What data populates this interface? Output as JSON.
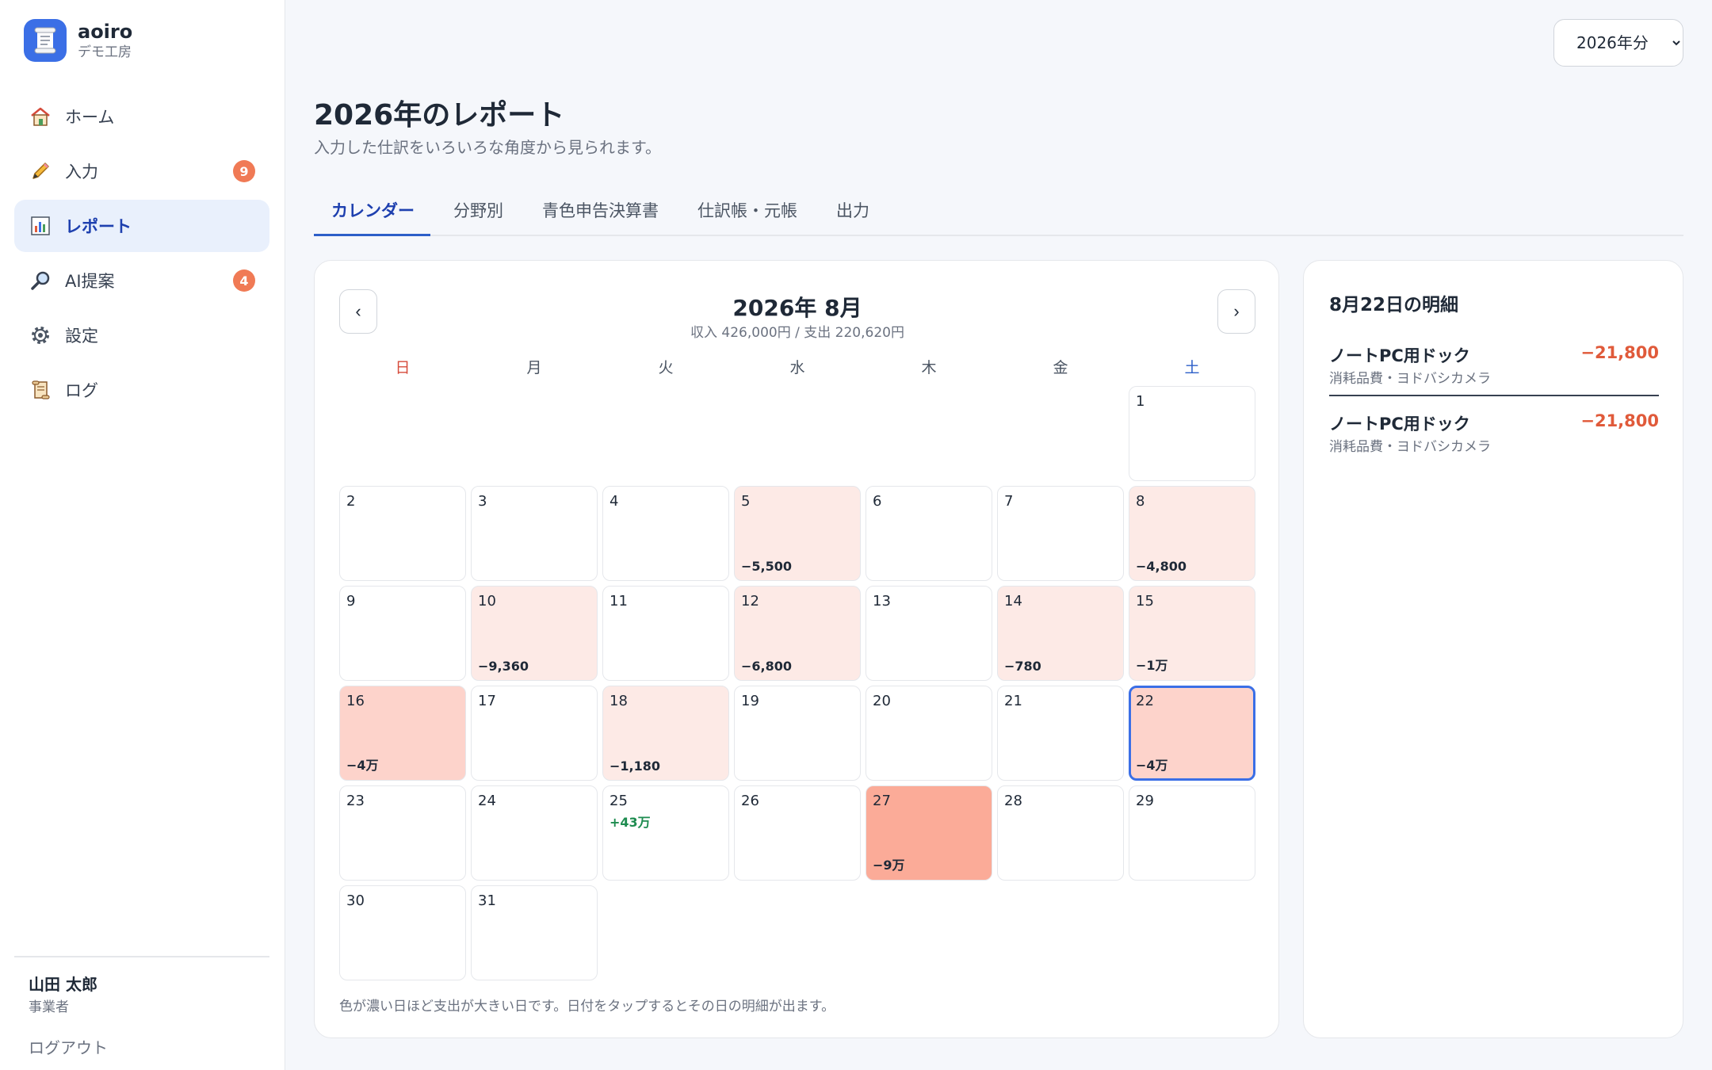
{
  "brand": {
    "name": "aoiro",
    "sub": "デモ工房"
  },
  "nav": [
    {
      "label": "ホーム",
      "icon": "home-icon",
      "badge": ""
    },
    {
      "label": "入力",
      "icon": "pencil-icon",
      "badge": "9"
    },
    {
      "label": "レポート",
      "icon": "chart-icon",
      "badge": "",
      "active": true
    },
    {
      "label": "AI提案",
      "icon": "magnifier-icon",
      "badge": "4"
    },
    {
      "label": "設定",
      "icon": "gear-icon",
      "badge": ""
    },
    {
      "label": "ログ",
      "icon": "scroll-icon",
      "badge": ""
    }
  ],
  "user": {
    "name": "山田 太郎",
    "role": "事業者",
    "logout": "ログアウト"
  },
  "year_select": {
    "value": "2026年分"
  },
  "page": {
    "title": "2026年のレポート",
    "subtitle": "入力した仕訳をいろいろな角度から見られます。"
  },
  "tabs": [
    "カレンダー",
    "分野別",
    "青色申告決算書",
    "仕訳帳・元帳",
    "出力"
  ],
  "calendar": {
    "month_label": "2026年 8月",
    "summary": "収入 426,000円 / 支出 220,620円",
    "prev": "‹",
    "next": "›",
    "weekdays": [
      "日",
      "月",
      "火",
      "水",
      "木",
      "金",
      "土"
    ],
    "note": "色が濃い日ほど支出が大きい日です。日付をタップするとその日の明細が出ます。",
    "first_weekday": 6,
    "selected_day": 22,
    "days": [
      {
        "day": "1",
        "amount": "",
        "income": "",
        "level": 0
      },
      {
        "day": "2",
        "amount": "",
        "income": "",
        "level": 0
      },
      {
        "day": "3",
        "amount": "",
        "income": "",
        "level": 0
      },
      {
        "day": "4",
        "amount": "",
        "income": "",
        "level": 0
      },
      {
        "day": "5",
        "amount": "−5,500",
        "income": "",
        "level": 1
      },
      {
        "day": "6",
        "amount": "",
        "income": "",
        "level": 0
      },
      {
        "day": "7",
        "amount": "",
        "income": "",
        "level": 0
      },
      {
        "day": "8",
        "amount": "−4,800",
        "income": "",
        "level": 1
      },
      {
        "day": "9",
        "amount": "",
        "income": "",
        "level": 0
      },
      {
        "day": "10",
        "amount": "−9,360",
        "income": "",
        "level": 1
      },
      {
        "day": "11",
        "amount": "",
        "income": "",
        "level": 0
      },
      {
        "day": "12",
        "amount": "−6,800",
        "income": "",
        "level": 1
      },
      {
        "day": "13",
        "amount": "",
        "income": "",
        "level": 0
      },
      {
        "day": "14",
        "amount": "−780",
        "income": "",
        "level": 1
      },
      {
        "day": "15",
        "amount": "−1万",
        "income": "",
        "level": 1
      },
      {
        "day": "16",
        "amount": "−4万",
        "income": "",
        "level": 2
      },
      {
        "day": "17",
        "amount": "",
        "income": "",
        "level": 0
      },
      {
        "day": "18",
        "amount": "−1,180",
        "income": "",
        "level": 1
      },
      {
        "day": "19",
        "amount": "",
        "income": "",
        "level": 0
      },
      {
        "day": "20",
        "amount": "",
        "income": "",
        "level": 0
      },
      {
        "day": "21",
        "amount": "",
        "income": "",
        "level": 0
      },
      {
        "day": "22",
        "amount": "−4万",
        "income": "",
        "level": 2
      },
      {
        "day": "23",
        "amount": "",
        "income": "",
        "level": 0
      },
      {
        "day": "24",
        "amount": "",
        "income": "",
        "level": 0
      },
      {
        "day": "25",
        "amount": "",
        "income": "+43万",
        "level": 0
      },
      {
        "day": "26",
        "amount": "",
        "income": "",
        "level": 0
      },
      {
        "day": "27",
        "amount": "−9万",
        "income": "",
        "level": 3
      },
      {
        "day": "28",
        "amount": "",
        "income": "",
        "level": 0
      },
      {
        "day": "29",
        "amount": "",
        "income": "",
        "level": 0
      },
      {
        "day": "30",
        "amount": "",
        "income": "",
        "level": 0
      },
      {
        "day": "31",
        "amount": "",
        "income": "",
        "level": 0
      }
    ],
    "heat_colors": [
      "#ffffff",
      "#fdeae6",
      "#fdd3cb",
      "#fbab98"
    ]
  },
  "detail": {
    "title": "8月22日の明細",
    "entries": [
      {
        "name": "ノートPC用ドック",
        "sub": "消耗品費・ヨドバシカメラ",
        "amount": "−21,800"
      },
      {
        "name": "ノートPC用ドック",
        "sub": "消耗品費・ヨドバシカメラ",
        "amount": "−21,800"
      }
    ]
  }
}
